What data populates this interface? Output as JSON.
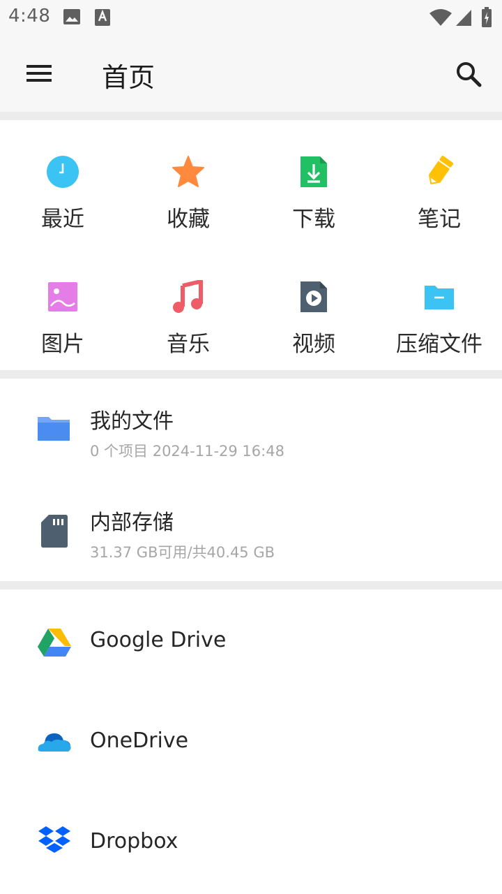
{
  "status_bar": {
    "time": "4:48",
    "icons": [
      "image-icon",
      "text-a-icon",
      "wifi-icon",
      "signal-icon",
      "battery-icon"
    ]
  },
  "app_bar": {
    "title": "首页",
    "menu_icon": "hamburger-menu-icon",
    "search_icon": "search-icon"
  },
  "categories": [
    {
      "label": "最近",
      "icon": "clock-icon",
      "color": "#3bc3f4"
    },
    {
      "label": "收藏",
      "icon": "star-icon",
      "color": "#ff8a3d"
    },
    {
      "label": "下载",
      "icon": "download-file-icon",
      "color": "#21c065"
    },
    {
      "label": "笔记",
      "icon": "pencil-icon",
      "color": "#ffc107"
    },
    {
      "label": "图片",
      "icon": "image-icon",
      "color": "#e47ee6"
    },
    {
      "label": "音乐",
      "icon": "music-note-icon",
      "color": "#ee5d67"
    },
    {
      "label": "视频",
      "icon": "video-file-icon",
      "color": "#4e5f70"
    },
    {
      "label": "压缩文件",
      "icon": "archive-folder-icon",
      "color": "#3bc3f4"
    }
  ],
  "storage": [
    {
      "name": "我的文件",
      "detail": "0 个项目 2024-11-29 16:48",
      "icon": "folder-icon",
      "color": "#4a8cf0"
    },
    {
      "name": "内部存储",
      "detail": "31.37 GB可用/共40.45 GB",
      "icon": "sd-card-icon",
      "color": "#4e5f70"
    }
  ],
  "cloud": [
    {
      "name": "Google Drive",
      "icon": "google-drive-icon"
    },
    {
      "name": "OneDrive",
      "icon": "onedrive-icon"
    },
    {
      "name": "Dropbox",
      "icon": "dropbox-icon"
    }
  ]
}
